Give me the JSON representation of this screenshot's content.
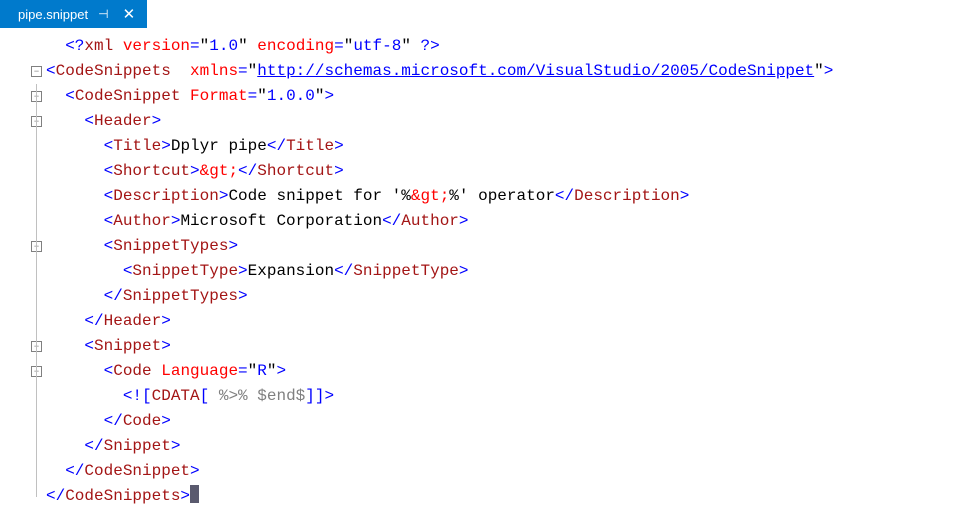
{
  "tab": {
    "filename": "pipe.snippet"
  },
  "code": {
    "xmlDecl": {
      "version": "1.0",
      "encoding": "utf-8"
    },
    "ns": "http://schemas.microsoft.com/VisualStudio/2005/CodeSnippet",
    "format": "1.0.0",
    "title": "Dplyr pipe",
    "shortcut": "&gt;",
    "description": "Code snippet for '%&gt;%' operator",
    "author": "Microsoft Corporation",
    "snippetType": "Expansion",
    "language": "R",
    "cdata": " %>% $end$"
  },
  "tags": {
    "codeSnippets": "CodeSnippets",
    "codeSnippet": "CodeSnippet",
    "header": "Header",
    "title": "Title",
    "shortcut": "Shortcut",
    "description": "Description",
    "author": "Author",
    "snippetTypes": "SnippetTypes",
    "snippetType": "SnippetType",
    "snippet": "Snippet",
    "code": "Code"
  },
  "attrs": {
    "version": "version",
    "encoding": "encoding",
    "xmlns": "xmlns",
    "format": "Format",
    "language": "Language"
  }
}
